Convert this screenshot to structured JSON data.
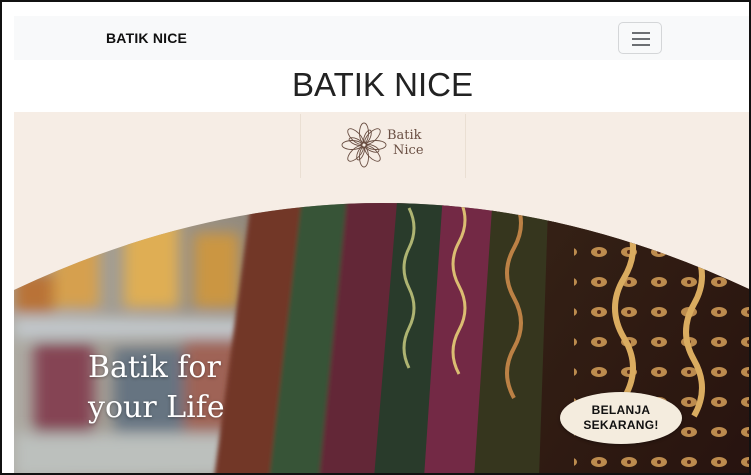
{
  "navbar": {
    "brand": "BATIK NICE",
    "toggler_icon": "hamburger-menu-icon"
  },
  "header": {
    "title": "BATIK NICE"
  },
  "hero": {
    "logo": {
      "line1": "Batik",
      "line2": "Nice",
      "icon": "mandala-flower-icon"
    },
    "tagline": {
      "line1": "Batik for",
      "line2": "your Life"
    },
    "cta": {
      "line1": "BELANJA",
      "line2": "SEKARANG!"
    }
  },
  "colors": {
    "navbar_bg": "#f8f9fa",
    "hero_bg": "#f6ede5",
    "logo_color": "#6a4f43",
    "cta_bg": "#f4ecde"
  }
}
